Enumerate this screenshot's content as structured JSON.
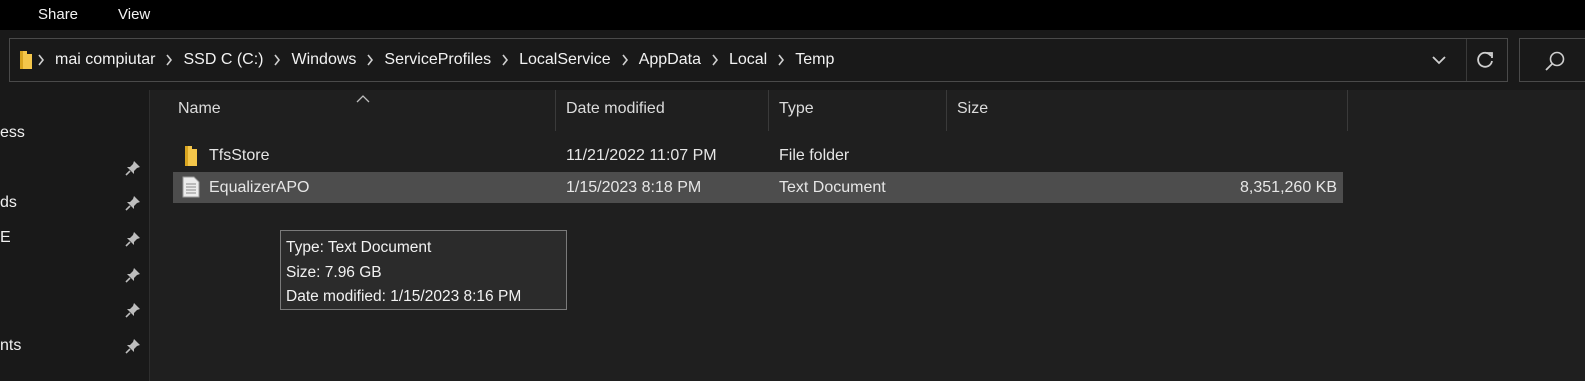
{
  "ribbon": {
    "tabs": [
      "Share",
      "View"
    ]
  },
  "address_bar": {
    "path": [
      "mai compiutar",
      "SSD C  (C:)",
      "Windows",
      "ServiceProfiles",
      "LocalService",
      "AppData",
      "Local",
      "Temp"
    ]
  },
  "nav_pane": {
    "items": [
      "ess",
      "",
      "ds",
      "E",
      "",
      "",
      "nts"
    ]
  },
  "file_list": {
    "columns": {
      "name": "Name",
      "date": "Date modified",
      "type": "Type",
      "size": "Size"
    },
    "rows": [
      {
        "name": "TfsStore",
        "date": "11/21/2022 11:07 PM",
        "type": "File folder",
        "size": "",
        "icon": "folder-icon"
      },
      {
        "name": "EqualizerAPO",
        "date": "1/15/2023 8:18 PM",
        "type": "Text Document",
        "size": "8,351,260 KB",
        "icon": "text-document-icon"
      }
    ]
  },
  "tooltip": {
    "lines": [
      "Type: Text Document",
      "Size: 7.96 GB",
      "Date modified: 1/15/2023 8:16 PM"
    ]
  },
  "colors": {
    "background": "#191919",
    "selected_row": "#4d4d4d",
    "folder": "#f4c64a"
  }
}
